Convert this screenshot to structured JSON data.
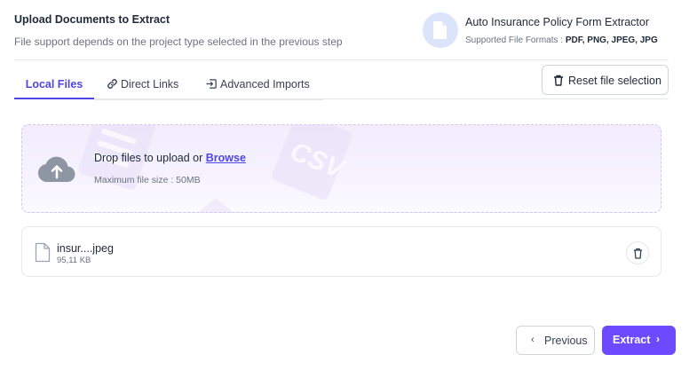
{
  "header": {
    "title": "Upload Documents to Extract",
    "subtitle": "File support depends on the project type selected in the previous step"
  },
  "project": {
    "icon": "document-icon",
    "name": "Auto Insurance Policy Form Extractor",
    "formats_label": "Supported File Formats :",
    "formats": "PDF, PNG, JPEG, JPG"
  },
  "tabs": [
    {
      "label": "Local Files",
      "icon": "",
      "active": true
    },
    {
      "label": "Direct Links",
      "icon": "link-icon",
      "active": false
    },
    {
      "label": "Advanced Imports",
      "icon": "import-icon",
      "active": false
    }
  ],
  "reset_button": {
    "label": "Reset file selection",
    "icon": "trash-icon"
  },
  "dropzone": {
    "prompt": "Drop files to upload or",
    "browse_label": "Browse",
    "max_size": "Maximum file size : 50MB",
    "icon": "cloud-upload-icon",
    "decor_text": "CSV"
  },
  "files": [
    {
      "name": "insur....jpeg",
      "size": "95,11 KB",
      "icon": "file-icon"
    }
  ],
  "footer": {
    "previous_label": "Previous",
    "extract_label": "Extract"
  },
  "colors": {
    "accent": "#4f46e5",
    "primary_button": "#6d4aff",
    "dropzone_bg": "#f1edfd",
    "dropzone_border": "#cfc6f2"
  }
}
